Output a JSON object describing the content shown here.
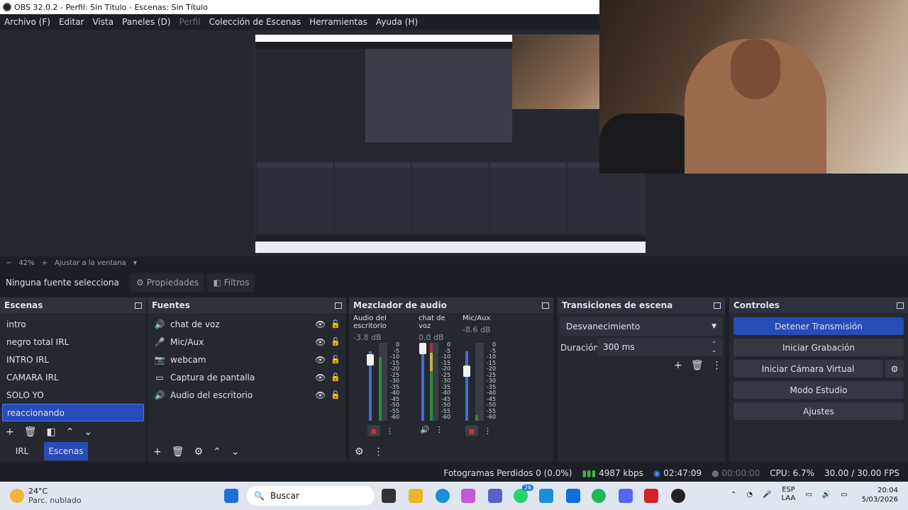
{
  "window": {
    "title": "OBS 32.0.2 - Perfil: Sin Título - Escenas: Sin Título"
  },
  "menu": [
    "Archivo (F)",
    "Editar",
    "Vista",
    "Paneles (D)",
    "Perfil",
    "Colección de Escenas",
    "Herramientas",
    "Ayuda (H)"
  ],
  "zoom": {
    "minus": "−",
    "value": "42%",
    "plus": "+",
    "fit": "Ajustar a la ventana",
    "arrow": "▾"
  },
  "source_bar": {
    "none": "Ninguna fuente selecciona",
    "properties": "Propiedades",
    "filters": "Filtros"
  },
  "scenes": {
    "title": "Escenas",
    "items": [
      "intro",
      "negro total IRL",
      "INTRO IRL",
      "CAMARA IRL",
      "SOLO YO",
      "reaccionando"
    ],
    "tabs": [
      "IRL",
      "Escenas"
    ]
  },
  "sources": {
    "title": "Fuentes",
    "items": [
      {
        "icon": "speaker-icon",
        "label": "chat de voz"
      },
      {
        "icon": "microphone-icon",
        "label": "Mic/Aux"
      },
      {
        "icon": "camera-icon",
        "label": "webcam"
      },
      {
        "icon": "monitor-icon",
        "label": "Captura de pantalla"
      },
      {
        "icon": "speaker-icon",
        "label": "Audio del escritorio"
      }
    ]
  },
  "mixer": {
    "title": "Mezclador de audio",
    "channels": [
      {
        "name": "Audio del escritorio",
        "db": "-3.8 dB"
      },
      {
        "name": "chat de voz",
        "db": "0.0 dB"
      },
      {
        "name": "Mic/Aux",
        "db": "-8.6 dB"
      }
    ],
    "scale": [
      "0",
      "-5",
      "-10",
      "-15",
      "-20",
      "-25",
      "-30",
      "-35",
      "-40",
      "-45",
      "-50",
      "-55",
      "-60"
    ]
  },
  "transitions": {
    "title": "Transiciones de escena",
    "selected": "Desvanecimiento",
    "duration_label": "Duración",
    "duration_value": "300 ms"
  },
  "controls": {
    "title": "Controles",
    "buttons": [
      "Detener Transmisión",
      "Iniciar Grabación",
      "Iniciar Cámara Virtual",
      "Modo Estudio",
      "Ajustes"
    ]
  },
  "status": {
    "dropped": "Fotogramas Perdidos 0 (0.0%)",
    "bitrate": "4987 kbps",
    "stream_time": "02:47:09",
    "rec_time": "00:00:00",
    "cpu": "CPU: 6.7%",
    "fps": "30.00 / 30.00 FPS"
  },
  "taskbar": {
    "temp": "24°C",
    "weather": "Parc. nublado",
    "search": "Buscar",
    "whatsapp_badge": "26",
    "lang1": "ESP",
    "lang2": "LAA",
    "time": "20:04",
    "date": "5/03/2026"
  }
}
